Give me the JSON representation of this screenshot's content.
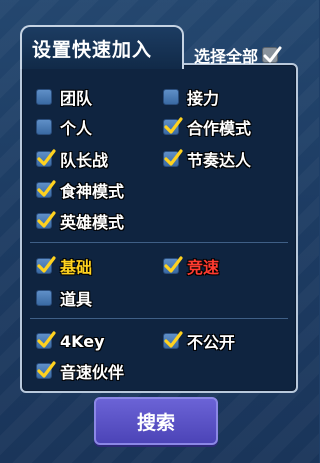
{
  "panel": {
    "title": "设置快速加入"
  },
  "select_all": {
    "label": "选择全部",
    "checked": true
  },
  "groups": [
    {
      "items": [
        {
          "label": "团队",
          "checked": false
        },
        {
          "label": "接力",
          "checked": false
        },
        {
          "label": "个人",
          "checked": false
        },
        {
          "label": "合作模式",
          "checked": true
        },
        {
          "label": "队长战",
          "checked": true
        },
        {
          "label": "节奏达人",
          "checked": true
        },
        {
          "label": "食神模式",
          "checked": true
        },
        {
          "label": "英雄模式",
          "checked": true
        }
      ]
    },
    {
      "items": [
        {
          "label": "基础",
          "checked": true,
          "color": "#ffd21f"
        },
        {
          "label": "竞速",
          "checked": true,
          "color": "#ff3b30"
        },
        {
          "label": "道具",
          "checked": false
        }
      ]
    },
    {
      "items": [
        {
          "label": "4Key",
          "checked": true
        },
        {
          "label": "不公开",
          "checked": true
        },
        {
          "label": "音速伙伴",
          "checked": true
        }
      ]
    }
  ],
  "search_button": {
    "label": "搜索"
  },
  "colors": {
    "accent": "#5a52c9",
    "check": "#ffd21f",
    "panel": "#0f2440"
  }
}
